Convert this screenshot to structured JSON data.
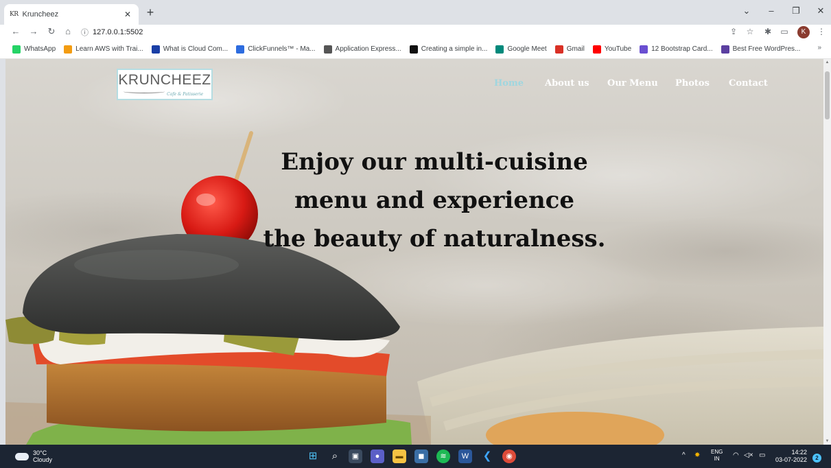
{
  "browser": {
    "tab": {
      "favicon_text": "KR",
      "title": "Kruncheez"
    },
    "address": {
      "url": "127.0.0.1:5502"
    },
    "bookmarks": [
      {
        "label": "WhatsApp",
        "color": "#25d366"
      },
      {
        "label": "Learn AWS with Trai...",
        "color": "#f39c12"
      },
      {
        "label": "What is Cloud Com...",
        "color": "#1a3fa6"
      },
      {
        "label": "ClickFunnels™ - Ma...",
        "color": "#2d6cdf"
      },
      {
        "label": "Application Express...",
        "color": "#555555"
      },
      {
        "label": "Creating a simple in...",
        "color": "#111111"
      },
      {
        "label": "Google Meet",
        "color": "#00897b"
      },
      {
        "label": "Gmail",
        "color": "#d93025"
      },
      {
        "label": "YouTube",
        "color": "#ff0000"
      },
      {
        "label": "12 Bootstrap Card...",
        "color": "#6a4fd1"
      },
      {
        "label": "Best Free WordPres...",
        "color": "#5b3fa0"
      }
    ],
    "bookmarks_more": "»",
    "profile_initial": "K"
  },
  "site": {
    "logo": {
      "word": "KRUNCHEEZ",
      "tagline": "Cafe & Patisserie"
    },
    "nav": {
      "home": "Home",
      "about": "About us",
      "menu": "Our Menu",
      "photos": "Photos",
      "contact": "Contact"
    },
    "hero": {
      "line1": "Enjoy our multi-cuisine",
      "line2": "menu and experience",
      "line3": "the beauty of naturalness."
    },
    "colors": {
      "nav_active": "#9fd6df",
      "nav": "#ffffff",
      "logo_border": "#b5dde2"
    }
  },
  "taskbar": {
    "weather": {
      "temp": "30°C",
      "condition": "Cloudy"
    },
    "lang": {
      "top": "ENG",
      "bottom": "IN"
    },
    "clock": {
      "time": "14:22",
      "date": "03-07-2022"
    },
    "notifications": "2"
  }
}
